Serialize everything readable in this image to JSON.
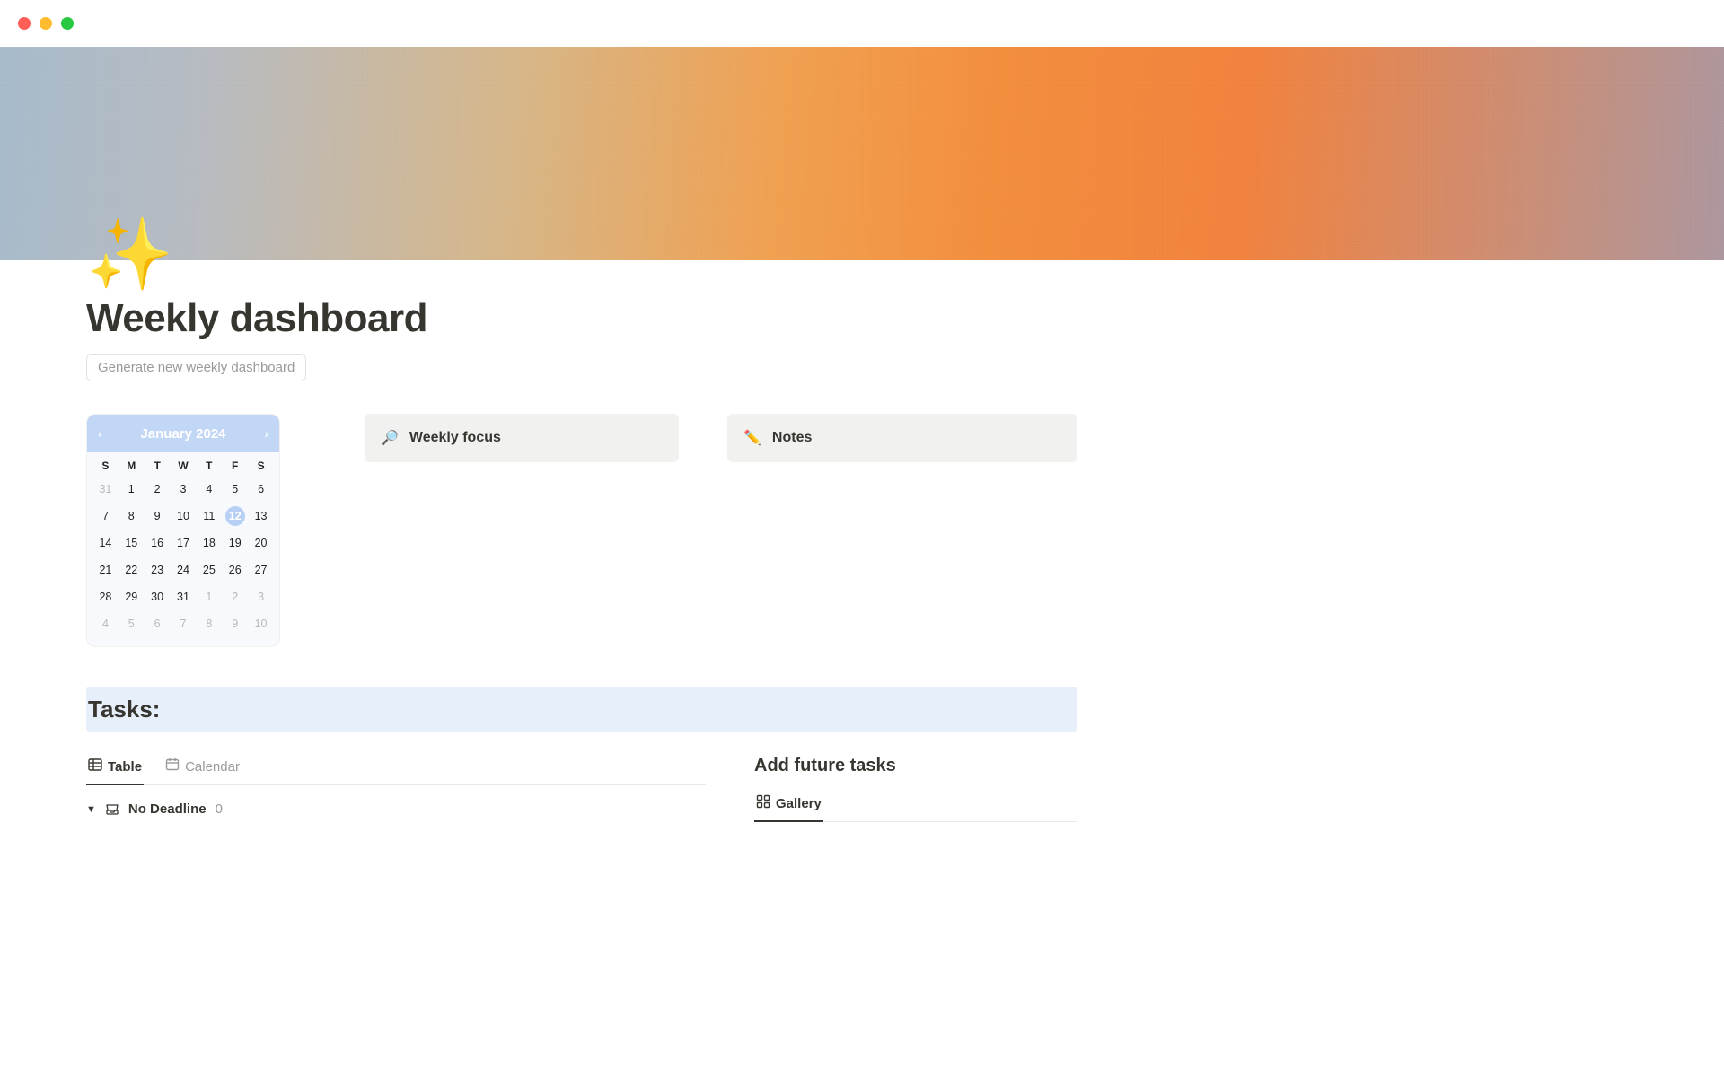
{
  "page": {
    "icon": "✨",
    "title": "Weekly dashboard",
    "generate_button": "Generate new weekly dashboard"
  },
  "calendar": {
    "month_label": "January 2024",
    "dow": [
      "S",
      "M",
      "T",
      "W",
      "T",
      "F",
      "S"
    ],
    "selected_day": 12,
    "cells": [
      {
        "n": 31,
        "dim": true
      },
      {
        "n": 1
      },
      {
        "n": 2
      },
      {
        "n": 3
      },
      {
        "n": 4
      },
      {
        "n": 5
      },
      {
        "n": 6
      },
      {
        "n": 7
      },
      {
        "n": 8
      },
      {
        "n": 9
      },
      {
        "n": 10
      },
      {
        "n": 11
      },
      {
        "n": 12,
        "sel": true
      },
      {
        "n": 13
      },
      {
        "n": 14
      },
      {
        "n": 15
      },
      {
        "n": 16
      },
      {
        "n": 17
      },
      {
        "n": 18
      },
      {
        "n": 19
      },
      {
        "n": 20
      },
      {
        "n": 21
      },
      {
        "n": 22
      },
      {
        "n": 23
      },
      {
        "n": 24
      },
      {
        "n": 25
      },
      {
        "n": 26
      },
      {
        "n": 27
      },
      {
        "n": 28
      },
      {
        "n": 29
      },
      {
        "n": 30
      },
      {
        "n": 31
      },
      {
        "n": 1,
        "dim": true
      },
      {
        "n": 2,
        "dim": true
      },
      {
        "n": 3,
        "dim": true
      },
      {
        "n": 4,
        "dim": true
      },
      {
        "n": 5,
        "dim": true
      },
      {
        "n": 6,
        "dim": true
      },
      {
        "n": 7,
        "dim": true
      },
      {
        "n": 8,
        "dim": true
      },
      {
        "n": 9,
        "dim": true
      },
      {
        "n": 10,
        "dim": true
      }
    ]
  },
  "callouts": {
    "focus": {
      "icon": "🔎",
      "title": "Weekly focus"
    },
    "notes": {
      "icon": "✏️",
      "title": "Notes"
    }
  },
  "tasks": {
    "heading": "Tasks:",
    "tabs": {
      "table": "Table",
      "calendar": "Calendar"
    },
    "group": {
      "label": "No Deadline",
      "count": "0"
    }
  },
  "future": {
    "heading": "Add future tasks",
    "tab": "Gallery"
  }
}
